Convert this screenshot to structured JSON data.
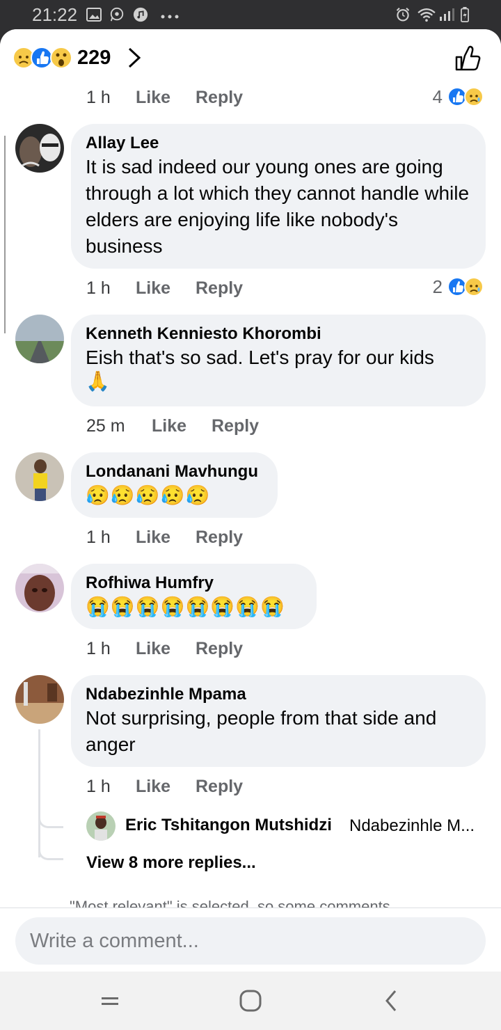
{
  "status_bar": {
    "time": "21:22",
    "icons": [
      "gallery-icon",
      "whatsapp-icon",
      "music-icon",
      "more-dots-icon",
      "alarm-icon",
      "wifi-icon",
      "signal-icon",
      "battery-icon"
    ]
  },
  "header": {
    "reaction_count": "229",
    "reactions": [
      "sad",
      "like",
      "wow"
    ]
  },
  "colors": {
    "like_blue": "#1877f2",
    "bubble_gray": "#f0f2f5",
    "meta_gray": "#65676b",
    "emoji_yellow": "#f7c948"
  },
  "comments": [
    {
      "author": "",
      "text": "",
      "time": "1 h",
      "like": "Like",
      "reply": "Reply",
      "reaction_count": "4",
      "reactions": [
        "like",
        "sad"
      ]
    },
    {
      "author": "Allay Lee",
      "text": "It is sad indeed our young ones are going through a lot which they cannot handle while elders are enjoying life like nobody's business",
      "time": "1 h",
      "like": "Like",
      "reply": "Reply",
      "reaction_count": "2",
      "reactions": [
        "like",
        "sad"
      ]
    },
    {
      "author": "Kenneth Kenniesto Khorombi",
      "text": "Eish that's so sad. Let's pray for our kids",
      "emoji": "🙏",
      "time": "25 m",
      "like": "Like",
      "reply": "Reply"
    },
    {
      "author": "Londanani Mavhungu",
      "emoji_row": "😥😥😥😥😥",
      "time": "1 h",
      "like": "Like",
      "reply": "Reply"
    },
    {
      "author": "Rofhiwa Humfry",
      "emoji_row": "😭😭😭😭😭😭😭😭",
      "time": "1 h",
      "like": "Like",
      "reply": "Reply"
    },
    {
      "author": "Ndabezinhle Mpama",
      "text": "Not surprising, people from that side and anger",
      "time": "1 h",
      "like": "Like",
      "reply": "Reply",
      "reply_preview": {
        "author": "Eric Tshitangon Mutshidzi",
        "snippet": "Ndabezinhle M..."
      },
      "view_more": "View 8 more replies..."
    }
  ],
  "footer_note": "\"Most relevant\" is selected, so some comments",
  "composer": {
    "placeholder": "Write a comment..."
  },
  "nav": [
    "recents-icon",
    "home-icon",
    "back-icon"
  ]
}
